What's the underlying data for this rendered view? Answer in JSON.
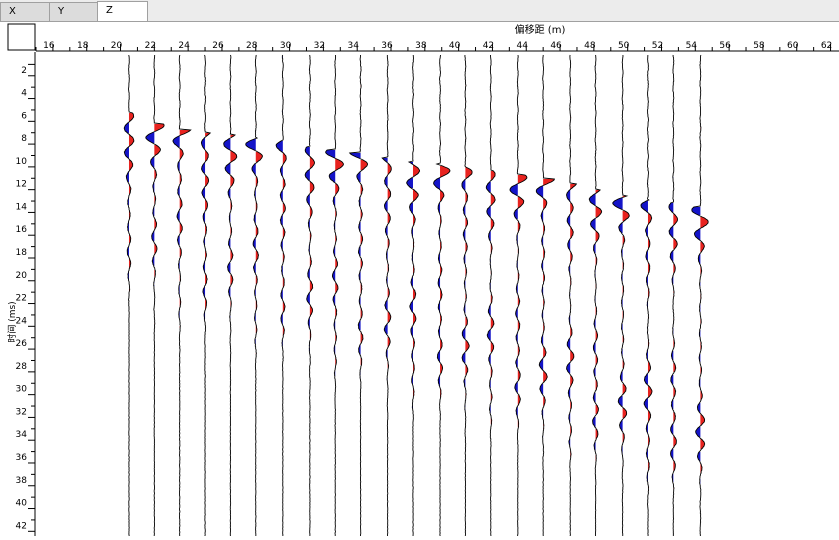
{
  "tabs": [
    {
      "label": "X",
      "active": false
    },
    {
      "label": "Y",
      "active": false
    },
    {
      "label": "Z",
      "active": true
    }
  ],
  "panel": {
    "x_axis_label": "偏移距 (m)",
    "y_axis_label": "时间 (ms)",
    "x_ticks": [
      "16",
      "18",
      "20",
      "22",
      "24",
      "26",
      "28",
      "30",
      "32",
      "34",
      "36",
      "38",
      "40",
      "42",
      "44",
      "46",
      "48",
      "50",
      "52",
      "54",
      "56",
      "58",
      "60",
      "62"
    ],
    "y_ticks": [
      "2",
      "4",
      "6",
      "8",
      "10",
      "12",
      "14",
      "16",
      "18",
      "20",
      "22",
      "24",
      "26",
      "28",
      "30",
      "32",
      "34",
      "36",
      "38",
      "40",
      "42"
    ]
  },
  "chart_data": {
    "type": "seismic-wiggle",
    "x_unit": "m",
    "y_unit": "ms",
    "xlim": [
      15,
      62.5
    ],
    "ylim": [
      0,
      42.5
    ],
    "trace_offsets_m": [
      20.5,
      22,
      23.5,
      25,
      26.5,
      28,
      29.6,
      31.2,
      32.7,
      34.2,
      35.8,
      37.3,
      38.9,
      40.4,
      41.9,
      43.5,
      45,
      46.6,
      48.1,
      49.7,
      51.2,
      52.7,
      54.3
    ],
    "first_arrival_ms": [
      5.5,
      6.5,
      7,
      7.3,
      7.5,
      7.7,
      8,
      8.5,
      8.8,
      9,
      9.5,
      9.8,
      10,
      10.3,
      10.6,
      11,
      11.3,
      11.8,
      12.3,
      12.8,
      13.2,
      13.4,
      13.8
    ],
    "colors": {
      "positive_fill": "#e8231f",
      "negative_fill": "#1414c8",
      "trace": "#000000"
    }
  }
}
